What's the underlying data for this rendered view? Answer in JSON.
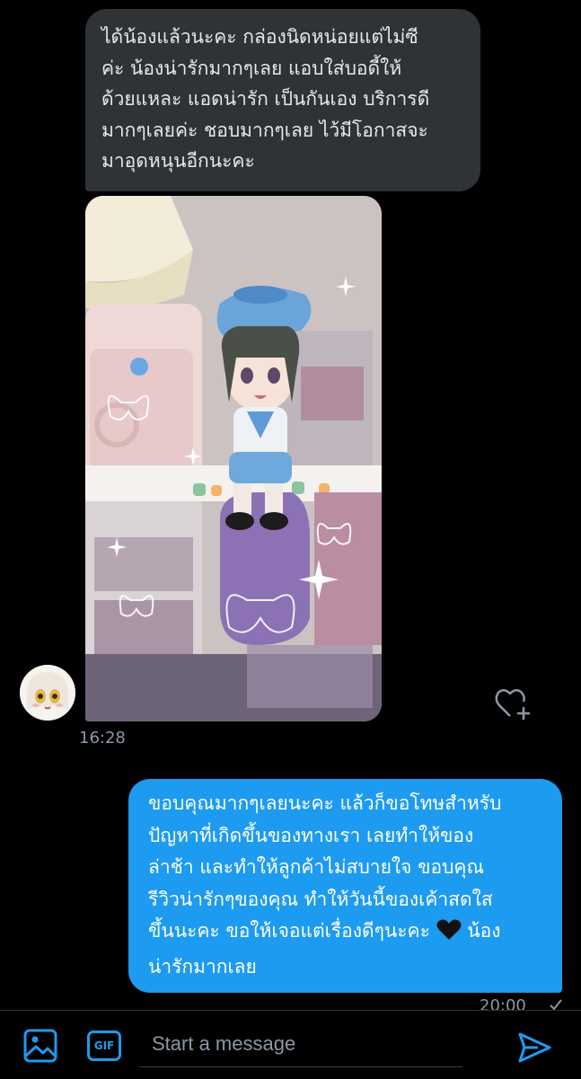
{
  "incoming_message": {
    "lines": [
      "ได้น้องแล้วนะคะ กล่องนิดหน่อยแต่ไม่ซี",
      "ค่ะ น้องน่ารักมากๆเลย แอบใส่บอดี้ให้",
      "ด้วยแหละ แอดน่ารัก เป็นกันเอง บริการดี",
      "มากๆเลยค่ะ ชอบมากๆเลย ไว้มีโอกาสจะ",
      "มาอุดหนุนอีกนะคะ"
    ],
    "timestamp": "16:28"
  },
  "outgoing_message": {
    "lines": [
      "ขอบคุณมากๆเลยนะคะ แล้วก็ขอโทษสำหรับ",
      "ปัญหาที่เกิดขึ้นของทางเรา เลยทำให้ของ",
      "ล่าช้า และทำให้ลูกค้าไม่สบายใจ ขอบคุณ",
      "รีวิวน่ารักๆของคุณ ทำให้วันนี้ของเค้าสดใส",
      "ขึ้นนะคะ ขอให้เจอแต่เรื่องดีๆนะคะ",
      "น้อง",
      "น่ารักมากเลย"
    ],
    "timestamp": "20:00"
  },
  "composer": {
    "placeholder": "Start a message",
    "gif_label": "GIF"
  },
  "icons": {
    "media": "image-icon",
    "gif": "gif-icon",
    "send": "send-icon",
    "react": "heart-plus-icon",
    "read": "checkmark-icon"
  },
  "colors": {
    "background": "#000000",
    "incoming_bubble": "#2f3336",
    "outgoing_bubble": "#1d9bf0",
    "accent": "#1d9bf0",
    "muted_text": "#8b98a5"
  }
}
